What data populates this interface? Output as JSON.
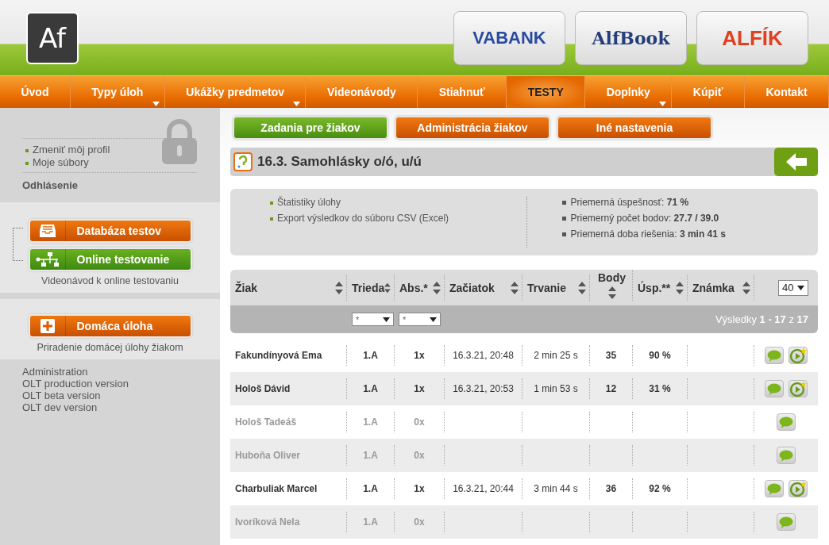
{
  "header": {
    "logo": "Af",
    "banners": [
      {
        "label": "VABANK",
        "kind": "vabank"
      },
      {
        "label": "AlfBook",
        "kind": "alfbook"
      },
      {
        "label": "ALFÍK",
        "kind": "alfik"
      }
    ]
  },
  "nav": [
    {
      "label": "Úvod",
      "selected": false,
      "dropdown": false
    },
    {
      "label": "Typy úloh",
      "selected": false,
      "dropdown": true
    },
    {
      "label": "Ukážky predmetov",
      "selected": false,
      "dropdown": true
    },
    {
      "label": "Videonávody",
      "selected": false,
      "dropdown": false
    },
    {
      "label": "Stiahnuť",
      "selected": false,
      "dropdown": false
    },
    {
      "label": "TESTY",
      "selected": true,
      "dropdown": false
    },
    {
      "label": "Doplnky",
      "selected": false,
      "dropdown": true
    },
    {
      "label": "Kúpiť",
      "selected": false,
      "dropdown": false
    },
    {
      "label": "Kontakt",
      "selected": false,
      "dropdown": false
    }
  ],
  "sidebar": {
    "profile_links": [
      "Zmeniť môj profil",
      "Moje súbory"
    ],
    "logout": "Odhlásenie",
    "test_buttons": [
      {
        "label": "Databáza testov",
        "kind": "database",
        "selected": false
      },
      {
        "label": "Online testovanie",
        "kind": "network",
        "selected": true
      }
    ],
    "test_caption": "Videonávod k online testovaniu",
    "homework_button": {
      "label": "Domáca úloha",
      "kind": "plus",
      "selected": false
    },
    "homework_caption": "Priradenie domácej úlohy žiakom",
    "admin_links": [
      "Administration",
      "OLT production version",
      "OLT beta version",
      "OLT dev version"
    ]
  },
  "tabs": [
    {
      "label": "Zadania pre žiakov",
      "selected": true
    },
    {
      "label": "Administrácia žiakov",
      "selected": false
    },
    {
      "label": "Iné nastavenia",
      "selected": false
    }
  ],
  "task_title": "16.3. Samohlásky o/ó, u/ú",
  "stats": {
    "links": [
      "Štatistiky úlohy",
      "Export výsledkov do súboru CSV (Excel)"
    ],
    "values": [
      "Priemerná úspešnosť: **71 %**",
      "Priemerný počet bodov: **27.7 / 39.0**",
      "Priemerná doba riešenia: **3 min 41 s**"
    ]
  },
  "table": {
    "columns": [
      {
        "label": "Žiak",
        "kind": "sort"
      },
      {
        "label": "Trieda",
        "kind": "sort"
      },
      {
        "label": "Abs.*",
        "kind": "sort"
      },
      {
        "label": "Začiatok",
        "kind": "sort"
      },
      {
        "label": "Trvanie",
        "kind": "sort"
      },
      {
        "label": "Body",
        "kind": "sort-below"
      },
      {
        "label": "Úsp.**",
        "kind": "sort"
      },
      {
        "label": "Známka",
        "kind": "sort"
      }
    ],
    "page_size": "40",
    "filters": [
      "*",
      "*"
    ],
    "results": "Výsledky **1 - 17** z **17**",
    "rows": [
      {
        "cells": [
          "Fakundínyová Ema",
          "1.A",
          "1x",
          "16.3.21, 20:48",
          "2 min 25 s",
          "35",
          "90 %",
          ""
        ],
        "attempted": true
      },
      {
        "cells": [
          "Hološ Dávid",
          "1.A",
          "1x",
          "16.3.21, 20:53",
          "1 min 53 s",
          "12",
          "31 %",
          ""
        ],
        "attempted": true
      },
      {
        "cells": [
          "Hološ Tadeáš",
          "1.A",
          "0x",
          "",
          "",
          "",
          "",
          ""
        ],
        "attempted": false
      },
      {
        "cells": [
          "Huboňa Oliver",
          "1.A",
          "0x",
          "",
          "",
          "",
          "",
          ""
        ],
        "attempted": false
      },
      {
        "cells": [
          "Charbuliak Marcel",
          "1.A",
          "1x",
          "16.3.21, 20:44",
          "3 min 44 s",
          "36",
          "92 %",
          ""
        ],
        "attempted": true
      },
      {
        "cells": [
          "Ivoríková Nela",
          "1.A",
          "0x",
          "",
          "",
          "",
          "",
          ""
        ],
        "attempted": false
      }
    ]
  }
}
